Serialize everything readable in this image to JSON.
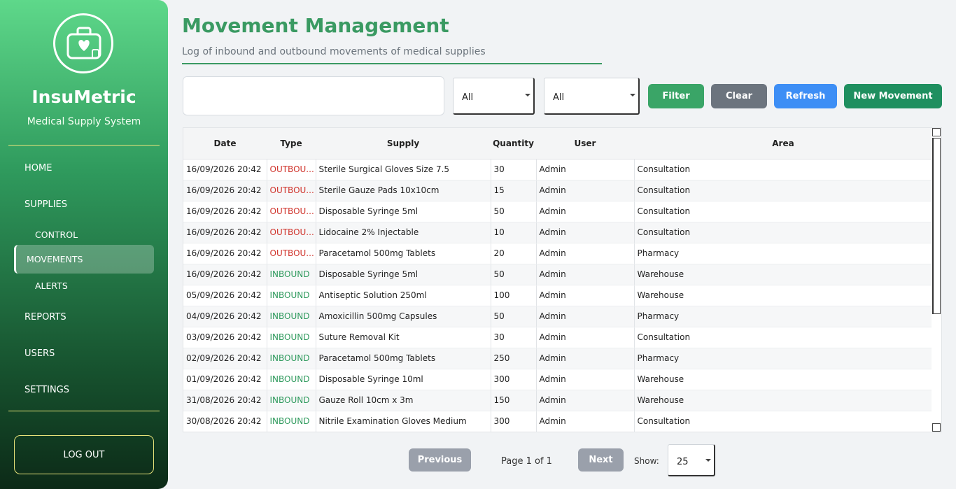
{
  "app": {
    "name": "InsuMetric",
    "subtitle": "Medical Supply System"
  },
  "nav": {
    "home": "HOME",
    "supplies": "SUPPLIES",
    "control": "CONTROL",
    "movements": "MOVEMENTS",
    "alerts": "ALERTS",
    "reports": "REPORTS",
    "users": "USERS",
    "settings": "SETTINGS",
    "logout": "LOG OUT"
  },
  "header": {
    "title": "Movement Management",
    "subtitle": "Log of inbound and outbound movements of medical supplies"
  },
  "filters": {
    "search_value": "",
    "type_select": "All",
    "area_select": "All",
    "filter_label": "Filter",
    "clear_label": "Clear",
    "refresh_label": "Refresh",
    "new_label": "New Movement"
  },
  "colors": {
    "filter": "#3aa567",
    "clear": "#6c747e",
    "refresh": "#3d8ef5",
    "new": "#1f8f5f"
  },
  "table": {
    "columns": [
      "Date",
      "Type",
      "Supply",
      "Quantity",
      "User",
      "Area"
    ],
    "rows": [
      {
        "date": "16/09/2026 20:42",
        "type": "OUTBOU...",
        "kind": "out",
        "supply": "Sterile Surgical Gloves Size 7.5",
        "qty": "30",
        "user": "Admin",
        "area": "Consultation"
      },
      {
        "date": "16/09/2026 20:42",
        "type": "OUTBOU...",
        "kind": "out",
        "supply": "Sterile Gauze Pads 10x10cm",
        "qty": "15",
        "user": "Admin",
        "area": "Consultation"
      },
      {
        "date": "16/09/2026 20:42",
        "type": "OUTBOU...",
        "kind": "out",
        "supply": "Disposable Syringe 5ml",
        "qty": "50",
        "user": "Admin",
        "area": "Consultation"
      },
      {
        "date": "16/09/2026 20:42",
        "type": "OUTBOU...",
        "kind": "out",
        "supply": "Lidocaine 2% Injectable",
        "qty": "10",
        "user": "Admin",
        "area": "Consultation"
      },
      {
        "date": "16/09/2026 20:42",
        "type": "OUTBOU...",
        "kind": "out",
        "supply": "Paracetamol 500mg Tablets",
        "qty": "20",
        "user": "Admin",
        "area": "Pharmacy"
      },
      {
        "date": "16/09/2026 20:42",
        "type": "INBOUND",
        "kind": "in",
        "supply": "Disposable Syringe 5ml",
        "qty": "50",
        "user": "Admin",
        "area": "Warehouse"
      },
      {
        "date": "05/09/2026 20:42",
        "type": "INBOUND",
        "kind": "in",
        "supply": "Antiseptic Solution 250ml",
        "qty": "100",
        "user": "Admin",
        "area": "Warehouse"
      },
      {
        "date": "04/09/2026 20:42",
        "type": "INBOUND",
        "kind": "in",
        "supply": "Amoxicillin 500mg Capsules",
        "qty": "50",
        "user": "Admin",
        "area": "Pharmacy"
      },
      {
        "date": "03/09/2026 20:42",
        "type": "INBOUND",
        "kind": "in",
        "supply": "Suture Removal Kit",
        "qty": "30",
        "user": "Admin",
        "area": "Consultation"
      },
      {
        "date": "02/09/2026 20:42",
        "type": "INBOUND",
        "kind": "in",
        "supply": "Paracetamol 500mg Tablets",
        "qty": "250",
        "user": "Admin",
        "area": "Pharmacy"
      },
      {
        "date": "01/09/2026 20:42",
        "type": "INBOUND",
        "kind": "in",
        "supply": "Disposable Syringe 10ml",
        "qty": "300",
        "user": "Admin",
        "area": "Warehouse"
      },
      {
        "date": "31/08/2026 20:42",
        "type": "INBOUND",
        "kind": "in",
        "supply": "Gauze Roll 10cm x 3m",
        "qty": "150",
        "user": "Admin",
        "area": "Warehouse"
      },
      {
        "date": "30/08/2026 20:42",
        "type": "INBOUND",
        "kind": "in",
        "supply": "Nitrile Examination Gloves Medium",
        "qty": "300",
        "user": "Admin",
        "area": "Consultation"
      }
    ]
  },
  "pager": {
    "previous": "Previous",
    "page_info": "Page 1 of 1",
    "next": "Next",
    "show_label": "Show:",
    "show_value": "25"
  }
}
